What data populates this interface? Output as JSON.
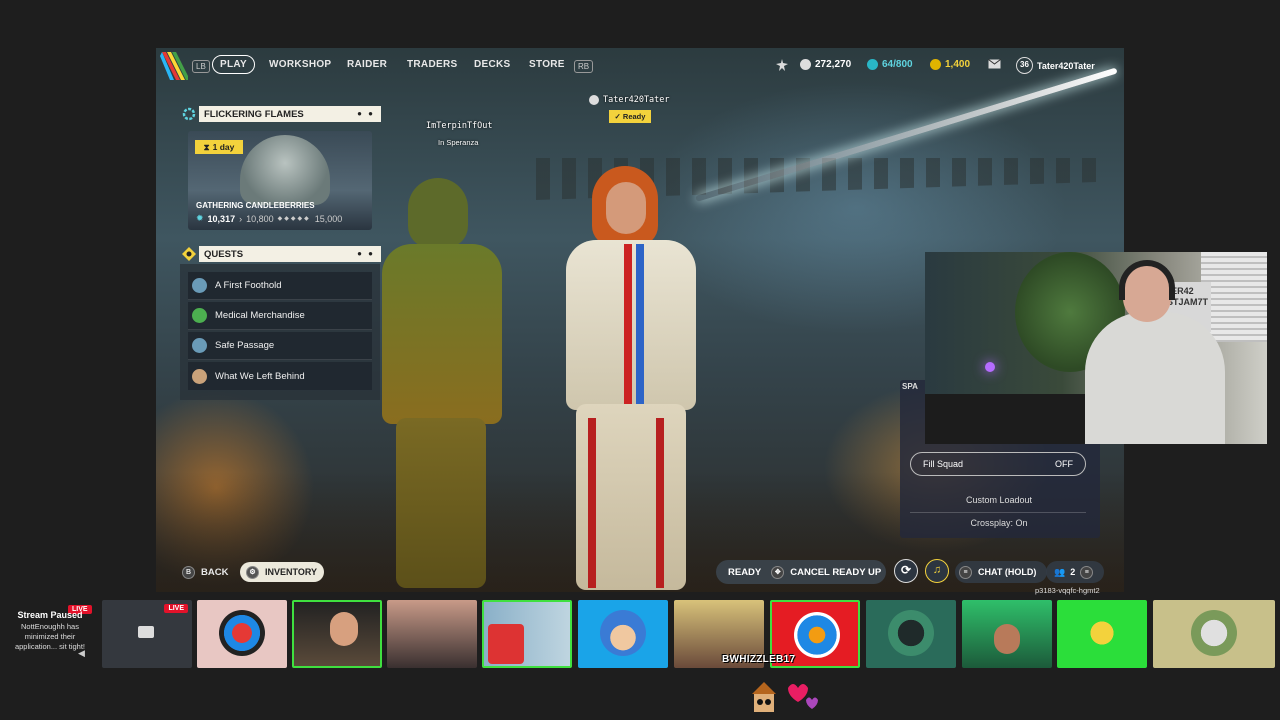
{
  "nav": {
    "lb": "LB",
    "rb": "RB",
    "items": [
      "PLAY",
      "WORKSHOP",
      "RAIDER",
      "TRADERS",
      "DECKS",
      "STORE"
    ]
  },
  "currency": {
    "coins": "272,270",
    "cred": "64/800",
    "tokens": "1,400",
    "level": "36",
    "username": "Tater420Tater"
  },
  "event": {
    "header": "FLICKERING FLAMES",
    "timer": "1 day",
    "name": "GATHERING CANDLEBERRIES",
    "current": "10,317",
    "next": "10,800",
    "target": "15,000"
  },
  "quests": {
    "header": "QUESTS",
    "items": [
      {
        "label": "A First Foothold",
        "color": "#6a9bb8"
      },
      {
        "label": "Medical Merchandise",
        "color": "#4caf50"
      },
      {
        "label": "Safe Passage",
        "color": "#6a9bb8"
      },
      {
        "label": "What We Left Behind",
        "color": "#c9a27a"
      }
    ]
  },
  "party": {
    "player1": "Tater420Tater",
    "player1_status": "Ready",
    "player2": "ImTerpinTfOut",
    "player2_location": "In Speranza"
  },
  "bottom": {
    "back": "BACK",
    "inventory": "INVENTORY",
    "ready": "READY",
    "cancel": "CANCEL READY UP",
    "chat": "CHAT (HOLD)",
    "party_count": "2",
    "session": "p3183-vqqfc-hgmt2"
  },
  "squad_menu": {
    "space": "SPA",
    "fill_squad": "Fill Squad",
    "fill_state": "OFF",
    "custom_loadout": "Custom Loadout",
    "crossplay": "Crossplay: On"
  },
  "webcam": {
    "sign_text": "TATER42 TUSTJAM7T K"
  },
  "stream": {
    "paused_title": "Stream Paused",
    "paused_msg": "NottEnoughh has minimized their application... sit tight!",
    "live": "LIVE",
    "bwhizzle": "BWHIZZLEB17"
  },
  "colors": {
    "accent_yellow": "#f3d23c",
    "live_red": "#e3122a",
    "select_green": "#3fe03f"
  }
}
